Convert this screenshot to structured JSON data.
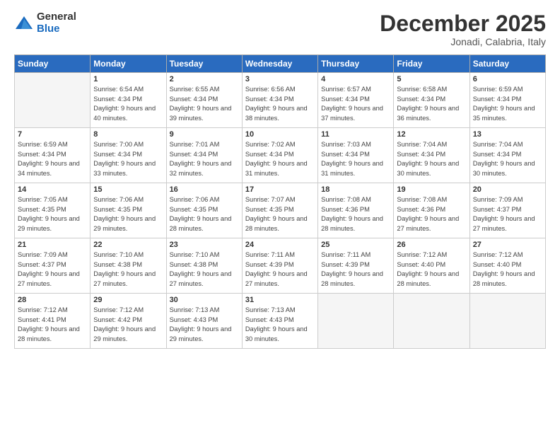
{
  "logo": {
    "general": "General",
    "blue": "Blue"
  },
  "title": "December 2025",
  "subtitle": "Jonadi, Calabria, Italy",
  "days_header": [
    "Sunday",
    "Monday",
    "Tuesday",
    "Wednesday",
    "Thursday",
    "Friday",
    "Saturday"
  ],
  "weeks": [
    [
      {
        "num": "",
        "sunrise": "",
        "sunset": "",
        "daylight": "",
        "empty": true
      },
      {
        "num": "1",
        "sunrise": "Sunrise: 6:54 AM",
        "sunset": "Sunset: 4:34 PM",
        "daylight": "Daylight: 9 hours and 40 minutes.",
        "empty": false
      },
      {
        "num": "2",
        "sunrise": "Sunrise: 6:55 AM",
        "sunset": "Sunset: 4:34 PM",
        "daylight": "Daylight: 9 hours and 39 minutes.",
        "empty": false
      },
      {
        "num": "3",
        "sunrise": "Sunrise: 6:56 AM",
        "sunset": "Sunset: 4:34 PM",
        "daylight": "Daylight: 9 hours and 38 minutes.",
        "empty": false
      },
      {
        "num": "4",
        "sunrise": "Sunrise: 6:57 AM",
        "sunset": "Sunset: 4:34 PM",
        "daylight": "Daylight: 9 hours and 37 minutes.",
        "empty": false
      },
      {
        "num": "5",
        "sunrise": "Sunrise: 6:58 AM",
        "sunset": "Sunset: 4:34 PM",
        "daylight": "Daylight: 9 hours and 36 minutes.",
        "empty": false
      },
      {
        "num": "6",
        "sunrise": "Sunrise: 6:59 AM",
        "sunset": "Sunset: 4:34 PM",
        "daylight": "Daylight: 9 hours and 35 minutes.",
        "empty": false
      }
    ],
    [
      {
        "num": "7",
        "sunrise": "Sunrise: 6:59 AM",
        "sunset": "Sunset: 4:34 PM",
        "daylight": "Daylight: 9 hours and 34 minutes.",
        "empty": false
      },
      {
        "num": "8",
        "sunrise": "Sunrise: 7:00 AM",
        "sunset": "Sunset: 4:34 PM",
        "daylight": "Daylight: 9 hours and 33 minutes.",
        "empty": false
      },
      {
        "num": "9",
        "sunrise": "Sunrise: 7:01 AM",
        "sunset": "Sunset: 4:34 PM",
        "daylight": "Daylight: 9 hours and 32 minutes.",
        "empty": false
      },
      {
        "num": "10",
        "sunrise": "Sunrise: 7:02 AM",
        "sunset": "Sunset: 4:34 PM",
        "daylight": "Daylight: 9 hours and 31 minutes.",
        "empty": false
      },
      {
        "num": "11",
        "sunrise": "Sunrise: 7:03 AM",
        "sunset": "Sunset: 4:34 PM",
        "daylight": "Daylight: 9 hours and 31 minutes.",
        "empty": false
      },
      {
        "num": "12",
        "sunrise": "Sunrise: 7:04 AM",
        "sunset": "Sunset: 4:34 PM",
        "daylight": "Daylight: 9 hours and 30 minutes.",
        "empty": false
      },
      {
        "num": "13",
        "sunrise": "Sunrise: 7:04 AM",
        "sunset": "Sunset: 4:34 PM",
        "daylight": "Daylight: 9 hours and 30 minutes.",
        "empty": false
      }
    ],
    [
      {
        "num": "14",
        "sunrise": "Sunrise: 7:05 AM",
        "sunset": "Sunset: 4:35 PM",
        "daylight": "Daylight: 9 hours and 29 minutes.",
        "empty": false
      },
      {
        "num": "15",
        "sunrise": "Sunrise: 7:06 AM",
        "sunset": "Sunset: 4:35 PM",
        "daylight": "Daylight: 9 hours and 29 minutes.",
        "empty": false
      },
      {
        "num": "16",
        "sunrise": "Sunrise: 7:06 AM",
        "sunset": "Sunset: 4:35 PM",
        "daylight": "Daylight: 9 hours and 28 minutes.",
        "empty": false
      },
      {
        "num": "17",
        "sunrise": "Sunrise: 7:07 AM",
        "sunset": "Sunset: 4:35 PM",
        "daylight": "Daylight: 9 hours and 28 minutes.",
        "empty": false
      },
      {
        "num": "18",
        "sunrise": "Sunrise: 7:08 AM",
        "sunset": "Sunset: 4:36 PM",
        "daylight": "Daylight: 9 hours and 28 minutes.",
        "empty": false
      },
      {
        "num": "19",
        "sunrise": "Sunrise: 7:08 AM",
        "sunset": "Sunset: 4:36 PM",
        "daylight": "Daylight: 9 hours and 27 minutes.",
        "empty": false
      },
      {
        "num": "20",
        "sunrise": "Sunrise: 7:09 AM",
        "sunset": "Sunset: 4:37 PM",
        "daylight": "Daylight: 9 hours and 27 minutes.",
        "empty": false
      }
    ],
    [
      {
        "num": "21",
        "sunrise": "Sunrise: 7:09 AM",
        "sunset": "Sunset: 4:37 PM",
        "daylight": "Daylight: 9 hours and 27 minutes.",
        "empty": false
      },
      {
        "num": "22",
        "sunrise": "Sunrise: 7:10 AM",
        "sunset": "Sunset: 4:38 PM",
        "daylight": "Daylight: 9 hours and 27 minutes.",
        "empty": false
      },
      {
        "num": "23",
        "sunrise": "Sunrise: 7:10 AM",
        "sunset": "Sunset: 4:38 PM",
        "daylight": "Daylight: 9 hours and 27 minutes.",
        "empty": false
      },
      {
        "num": "24",
        "sunrise": "Sunrise: 7:11 AM",
        "sunset": "Sunset: 4:39 PM",
        "daylight": "Daylight: 9 hours and 27 minutes.",
        "empty": false
      },
      {
        "num": "25",
        "sunrise": "Sunrise: 7:11 AM",
        "sunset": "Sunset: 4:39 PM",
        "daylight": "Daylight: 9 hours and 28 minutes.",
        "empty": false
      },
      {
        "num": "26",
        "sunrise": "Sunrise: 7:12 AM",
        "sunset": "Sunset: 4:40 PM",
        "daylight": "Daylight: 9 hours and 28 minutes.",
        "empty": false
      },
      {
        "num": "27",
        "sunrise": "Sunrise: 7:12 AM",
        "sunset": "Sunset: 4:40 PM",
        "daylight": "Daylight: 9 hours and 28 minutes.",
        "empty": false
      }
    ],
    [
      {
        "num": "28",
        "sunrise": "Sunrise: 7:12 AM",
        "sunset": "Sunset: 4:41 PM",
        "daylight": "Daylight: 9 hours and 28 minutes.",
        "empty": false
      },
      {
        "num": "29",
        "sunrise": "Sunrise: 7:12 AM",
        "sunset": "Sunset: 4:42 PM",
        "daylight": "Daylight: 9 hours and 29 minutes.",
        "empty": false
      },
      {
        "num": "30",
        "sunrise": "Sunrise: 7:13 AM",
        "sunset": "Sunset: 4:43 PM",
        "daylight": "Daylight: 9 hours and 29 minutes.",
        "empty": false
      },
      {
        "num": "31",
        "sunrise": "Sunrise: 7:13 AM",
        "sunset": "Sunset: 4:43 PM",
        "daylight": "Daylight: 9 hours and 30 minutes.",
        "empty": false
      },
      {
        "num": "",
        "sunrise": "",
        "sunset": "",
        "daylight": "",
        "empty": true
      },
      {
        "num": "",
        "sunrise": "",
        "sunset": "",
        "daylight": "",
        "empty": true
      },
      {
        "num": "",
        "sunrise": "",
        "sunset": "",
        "daylight": "",
        "empty": true
      }
    ]
  ]
}
